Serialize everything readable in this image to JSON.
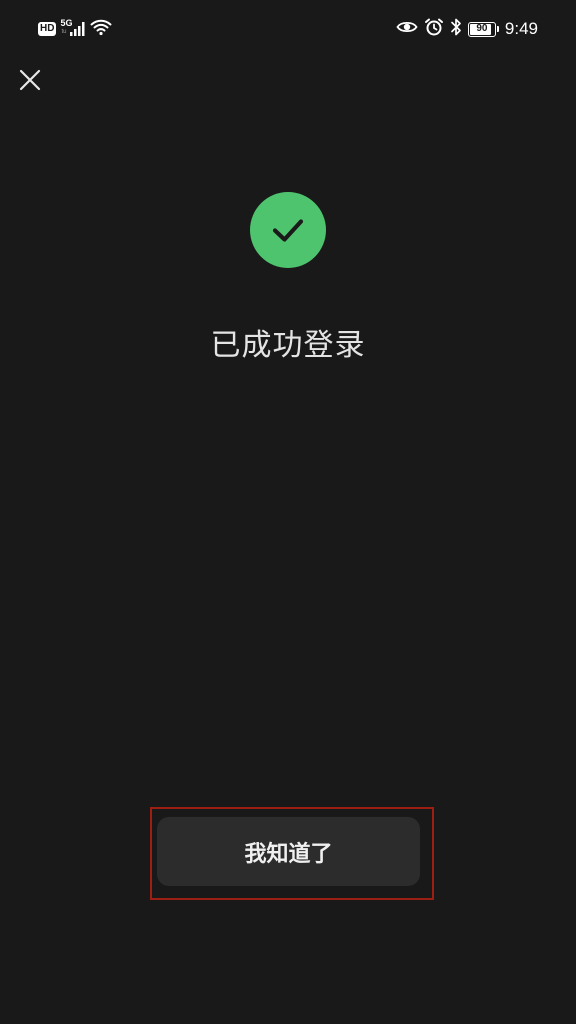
{
  "status_bar": {
    "hd_label": "HD",
    "network_type": "5G",
    "network_sub": "tu",
    "battery_level": "90",
    "battery_fraction": 0.9,
    "time": "9:49",
    "icons": [
      "signal-icon",
      "wifi-icon",
      "eye-icon",
      "alarm-icon",
      "bluetooth-icon",
      "battery-icon"
    ]
  },
  "header": {
    "close_icon": "close-icon"
  },
  "result": {
    "icon": "check-icon",
    "icon_color": "#4fc46f",
    "title": "已成功登录"
  },
  "footer": {
    "confirm_label": "我知道了",
    "highlight_color": "#9c1f14"
  }
}
